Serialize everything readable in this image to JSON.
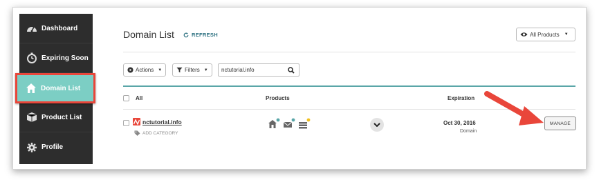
{
  "sidebar": {
    "items": [
      {
        "label": "Dashboard",
        "icon": "dashboard-gauge-icon"
      },
      {
        "label": "Expiring Soon",
        "icon": "stopwatch-icon"
      },
      {
        "label": "Domain List",
        "icon": "home-icon",
        "active": true
      },
      {
        "label": "Product List",
        "icon": "box-icon"
      },
      {
        "label": "Profile",
        "icon": "gear-icon"
      }
    ],
    "active_bg": "#7ccec4",
    "highlight_border": "#e9463a"
  },
  "header": {
    "title": "Domain List",
    "refresh_label": "REFRESH",
    "product_filter": "All Products"
  },
  "toolbar": {
    "actions_label": "Actions",
    "filters_label": "Filters",
    "search_value": "nctutorial.info"
  },
  "table": {
    "columns": {
      "all": "All",
      "products": "Products",
      "expiration": "Expiration"
    },
    "rows": [
      {
        "domain": "nctutorial.info",
        "add_category": "ADD CATEGORY",
        "product_icons": [
          "hosting-icon",
          "email-icon",
          "server-stack-icon"
        ],
        "expiration_date": "Oct 30, 2016",
        "expiration_type": "Domain",
        "manage_label": "MANAGE"
      }
    ]
  },
  "annotation": {
    "arrow_color": "#e9463a"
  }
}
